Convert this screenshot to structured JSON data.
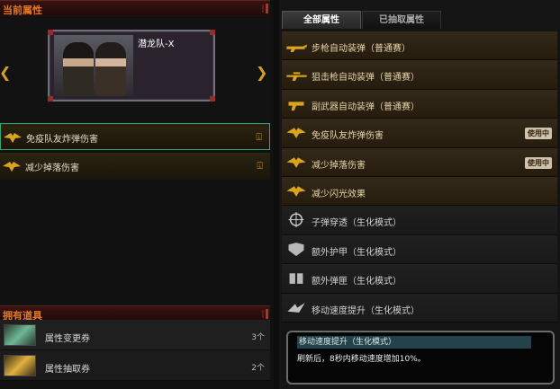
{
  "left": {
    "current_attr_title": "当前属性",
    "character": {
      "name": "潜龙队-X"
    },
    "nav": {
      "prev_icon": "chevron-left-icon",
      "next_icon": "chevron-right-icon"
    },
    "equipped": [
      {
        "label": "免疫队友炸弹伤害",
        "icon": "gold-eagle-icon",
        "pin": "⍗"
      },
      {
        "label": "减少掉落伤害",
        "icon": "gold-eagle-icon",
        "pin": "⍗"
      }
    ],
    "owned_title": "拥有道具",
    "inventory": [
      {
        "name": "属性变更券",
        "count": "3个"
      },
      {
        "name": "属性抽取券",
        "count": "2个"
      }
    ]
  },
  "right": {
    "tabs": {
      "all": "全部属性",
      "extracted": "已抽取属性"
    },
    "attributes": [
      {
        "label": "步枪自动装弹（普通赛）",
        "style": "gold",
        "icon": "rifle-icon",
        "badge": ""
      },
      {
        "label": "狙击枪自动装弹（普通赛）",
        "style": "gold",
        "icon": "sniper-icon",
        "badge": ""
      },
      {
        "label": "副武器自动装弹（普通赛）",
        "style": "gold",
        "icon": "pistol-icon",
        "badge": ""
      },
      {
        "label": "免疫队友炸弹伤害",
        "style": "gold",
        "icon": "gold-eagle-icon",
        "badge": "使用中"
      },
      {
        "label": "减少掉落伤害",
        "style": "gold",
        "icon": "gold-eagle-icon",
        "badge": "使用中"
      },
      {
        "label": "减少闪光效果",
        "style": "gold",
        "icon": "gold-eagle-icon",
        "badge": ""
      },
      {
        "label": "子弹穿透（生化模式）",
        "style": "dark",
        "icon": "crosshair-icon",
        "badge": ""
      },
      {
        "label": "额外护甲（生化模式）",
        "style": "dark",
        "icon": "armor-icon",
        "badge": ""
      },
      {
        "label": "额外弹匣（生化模式）",
        "style": "dark",
        "icon": "magazine-icon",
        "badge": ""
      },
      {
        "label": "移动速度提升（生化模式）",
        "style": "dark",
        "icon": "speed-icon",
        "badge": ""
      }
    ],
    "tooltip": {
      "title": "移动速度提升（生化模式）",
      "description": "刷新后，8秒内移动速度增加10%。"
    }
  }
}
